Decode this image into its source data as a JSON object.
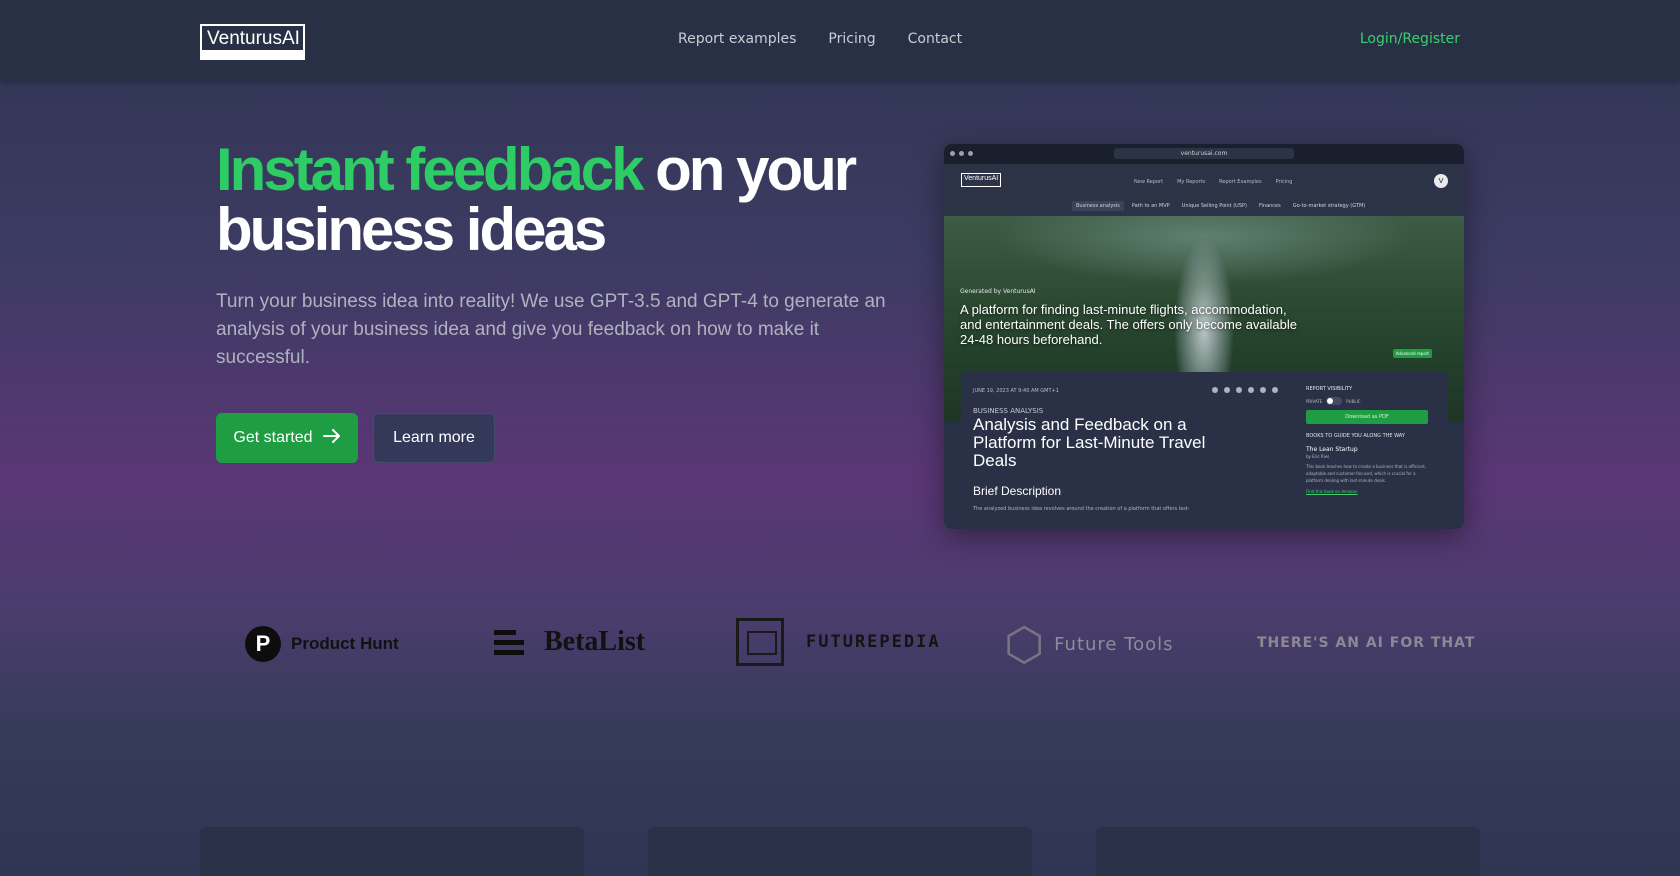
{
  "nav": {
    "logo": "VenturusAI",
    "links": [
      "Report examples",
      "Pricing",
      "Contact"
    ],
    "login": "Login/Register"
  },
  "hero": {
    "title_accent": "Instant feedback",
    "title_rest": " on your business ideas",
    "description": "Turn your business idea into reality! We use GPT-3.5 and GPT-4 to generate an analysis of your business idea and give you feedback on how to make it successful.",
    "primary_button": "Get started",
    "secondary_button": "Learn more"
  },
  "mockup": {
    "url": "venturusai.com",
    "logo": "VenturusAI",
    "nav_links": [
      "New Report",
      "My Reports",
      "Report Examples",
      "Pricing"
    ],
    "avatar": "V",
    "tabs": [
      "Business analysis",
      "Path to an MVP",
      "Unique Selling Point (USP)",
      "Finances",
      "Go-to-market strategy (GTM)"
    ],
    "generated_by": "Generated by VenturusAI",
    "headline": "A platform for finding last-minute flights, accommodation, and entertainment deals. The offers only become available 24-48 hours beforehand.",
    "advanced_badge": "Advanced report",
    "date": "JUNE 19, 2023 AT 9:40 AM GMT+1",
    "category": "BUSINESS ANALYSIS",
    "report_title": "Analysis and Feedback on a Platform for Last-Minute Travel Deals",
    "brief_heading": "Brief Description",
    "brief_body": "The analyzed business idea revolves around the creation of a platform that offers last-",
    "sidebar": {
      "visibility_label": "REPORT VISIBILITY",
      "private": "PRIVATE",
      "public": "PUBLIC",
      "download": "Download as PDF",
      "books_heading": "BOOKS TO GUIDE YOU ALONG THE WAY",
      "book_title": "The Lean Startup",
      "book_author": "by Eric Ries",
      "book_desc": "This book teaches how to create a business that is efficient, adaptable and customer-focused, which is crucial for a platform dealing with last-minute deals.",
      "book_link": "Find this book on Amazon"
    }
  },
  "partners": [
    "Product Hunt",
    "BetaList",
    "FUTUREPEDIA",
    "Future Tools",
    "THERE'S AN AI FOR THAT"
  ],
  "colors": {
    "accent": "#2ecc65",
    "button": "#1f9d43",
    "nav_bg": "#273044"
  }
}
